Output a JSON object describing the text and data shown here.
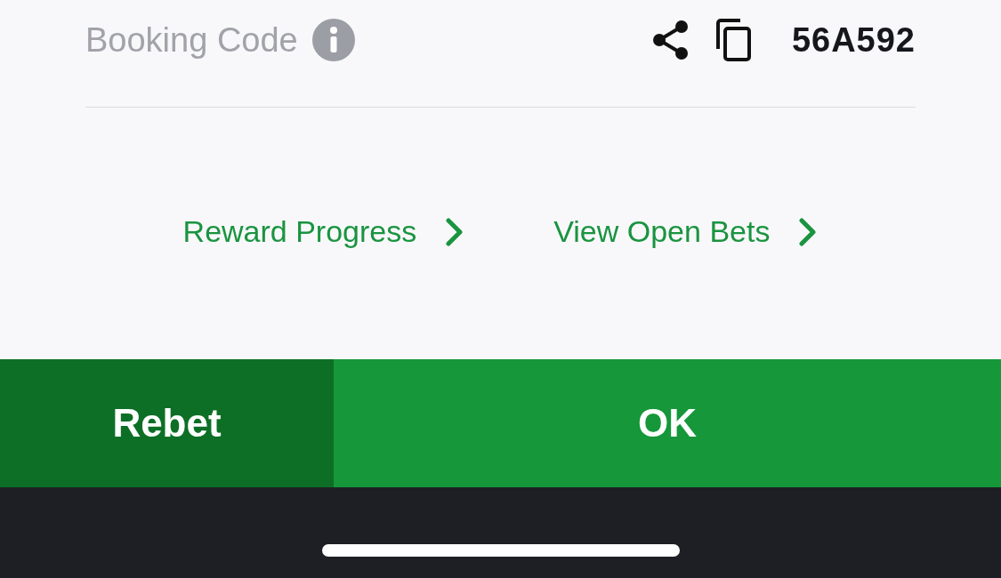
{
  "booking": {
    "label": "Booking Code",
    "code": "56A592"
  },
  "links": [
    {
      "label": "Reward Progress"
    },
    {
      "label": "View Open Bets"
    }
  ],
  "buttons": [
    {
      "label": "Rebet",
      "kind": "secondary"
    },
    {
      "label": "OK",
      "kind": "primary"
    }
  ]
}
